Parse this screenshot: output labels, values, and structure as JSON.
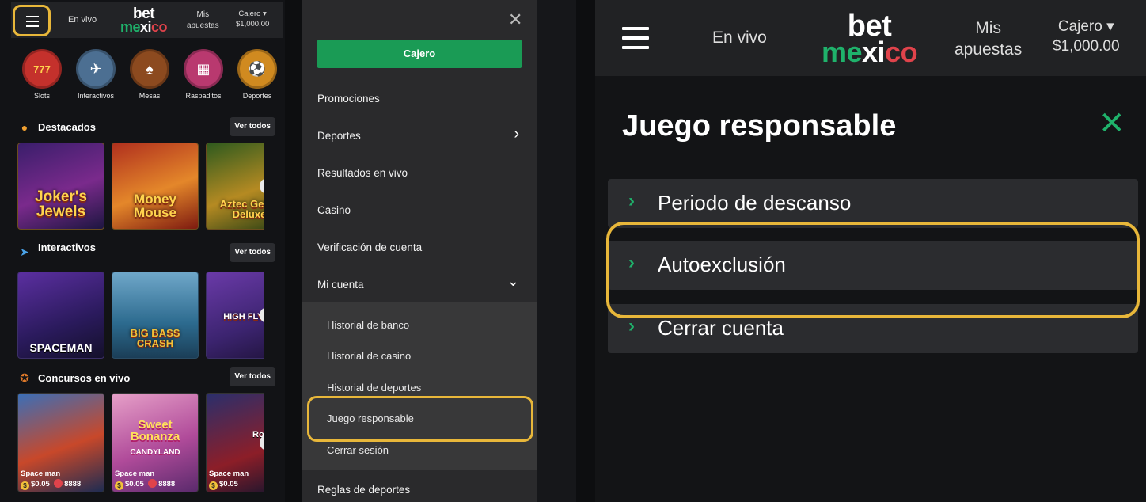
{
  "header": {
    "en_vivo": "En vivo",
    "logo_top": "bet",
    "logo_bottom_a": "me",
    "logo_bottom_x": "xi",
    "logo_bottom_b": "co",
    "mis_line1": "Mis",
    "mis_line2": "apuestas",
    "cajero_label": "Cajero ▾",
    "balance": "$1,000.00"
  },
  "categories": [
    {
      "label": "Slots",
      "glyph": "777",
      "color": "#c4312c"
    },
    {
      "label": "Interactivos",
      "glyph": "✈",
      "color": "#4c6f92"
    },
    {
      "label": "Mesas",
      "glyph": "♠",
      "color": "#8c4a1f"
    },
    {
      "label": "Raspaditos",
      "glyph": "▦",
      "color": "#b9396f"
    },
    {
      "label": "Deportes",
      "glyph": "⚽",
      "color": "#d08a20"
    }
  ],
  "sections": {
    "destacados": "Destacados",
    "interactivos": "Interactivos",
    "concursos": "Concursos en vivo",
    "ver_todos": "Ver todos"
  },
  "games_destacados": [
    "Joker's Jewels",
    "Money Mouse",
    "Aztec Gems Deluxe"
  ],
  "games_interactivos": [
    "Spaceman",
    "Big Bass Crash",
    "High Flyer"
  ],
  "games_live": [
    {
      "name": "Space man",
      "bet": "$0.05",
      "players": "8888"
    },
    {
      "name": "Space man",
      "bet": "$0.05",
      "players": "8888"
    },
    {
      "name": "Space man",
      "bet": "$0.05",
      "players": ""
    }
  ],
  "live_card_titles": [
    "",
    "Sweet Bonanza",
    "Roulette"
  ],
  "live_card_sub": "CANDYLAND",
  "drawer": {
    "close": "✕",
    "cajero_button": "Cajero",
    "items": [
      "Promociones",
      "Deportes",
      "Resultados en vivo",
      "Casino",
      "Verificación de cuenta",
      "Mi cuenta"
    ],
    "submenu": [
      "Historial de banco",
      "Historial de casino",
      "Historial de deportes",
      "Juego responsable",
      "Cerrar sesión"
    ],
    "bottom_item": "Reglas de deportes"
  },
  "responsible": {
    "title": "Juego responsable",
    "close": "✕",
    "options": [
      "Periodo de descanso",
      "Autoexclusión",
      "Cerrar cuenta"
    ]
  },
  "colors": {
    "highlight": "#e8b73a",
    "accent_green": "#1fb26b",
    "logo_red": "#e0434b"
  }
}
